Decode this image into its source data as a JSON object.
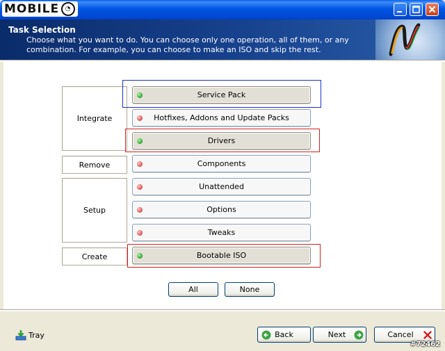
{
  "window": {
    "wordmark": "MOBILE",
    "header_title": "Task Selection",
    "header_description": "Choose what you want to do. You can choose only one operation, all of them, or any combination. For example, you can choose to make an ISO and skip the rest."
  },
  "categories": {
    "integrate": "Integrate",
    "remove": "Remove",
    "setup": "Setup",
    "create": "Create"
  },
  "tasks": [
    {
      "label": "Service Pack",
      "status": "green",
      "selected": true
    },
    {
      "label": "Hotfixes, Addons and Update Packs",
      "status": "red",
      "selected": false
    },
    {
      "label": "Drivers",
      "status": "green",
      "selected": true
    },
    {
      "label": "Components",
      "status": "red",
      "selected": false
    },
    {
      "label": "Unattended",
      "status": "red",
      "selected": false
    },
    {
      "label": "Options",
      "status": "red",
      "selected": false
    },
    {
      "label": "Tweaks",
      "status": "red",
      "selected": false
    },
    {
      "label": "Bootable ISO",
      "status": "green",
      "selected": true
    }
  ],
  "selection_buttons": {
    "all": "All",
    "none": "None"
  },
  "footer": {
    "tray": "Tray",
    "back": "Back",
    "next": "Next",
    "cancel": "Cancel"
  },
  "watermark": "#72462",
  "colors": {
    "header_bg": "#17428E",
    "highlight_blue": "#1C2FC8",
    "highlight_red": "#D42020",
    "status_green": "#38B038",
    "status_red": "#E06060"
  }
}
